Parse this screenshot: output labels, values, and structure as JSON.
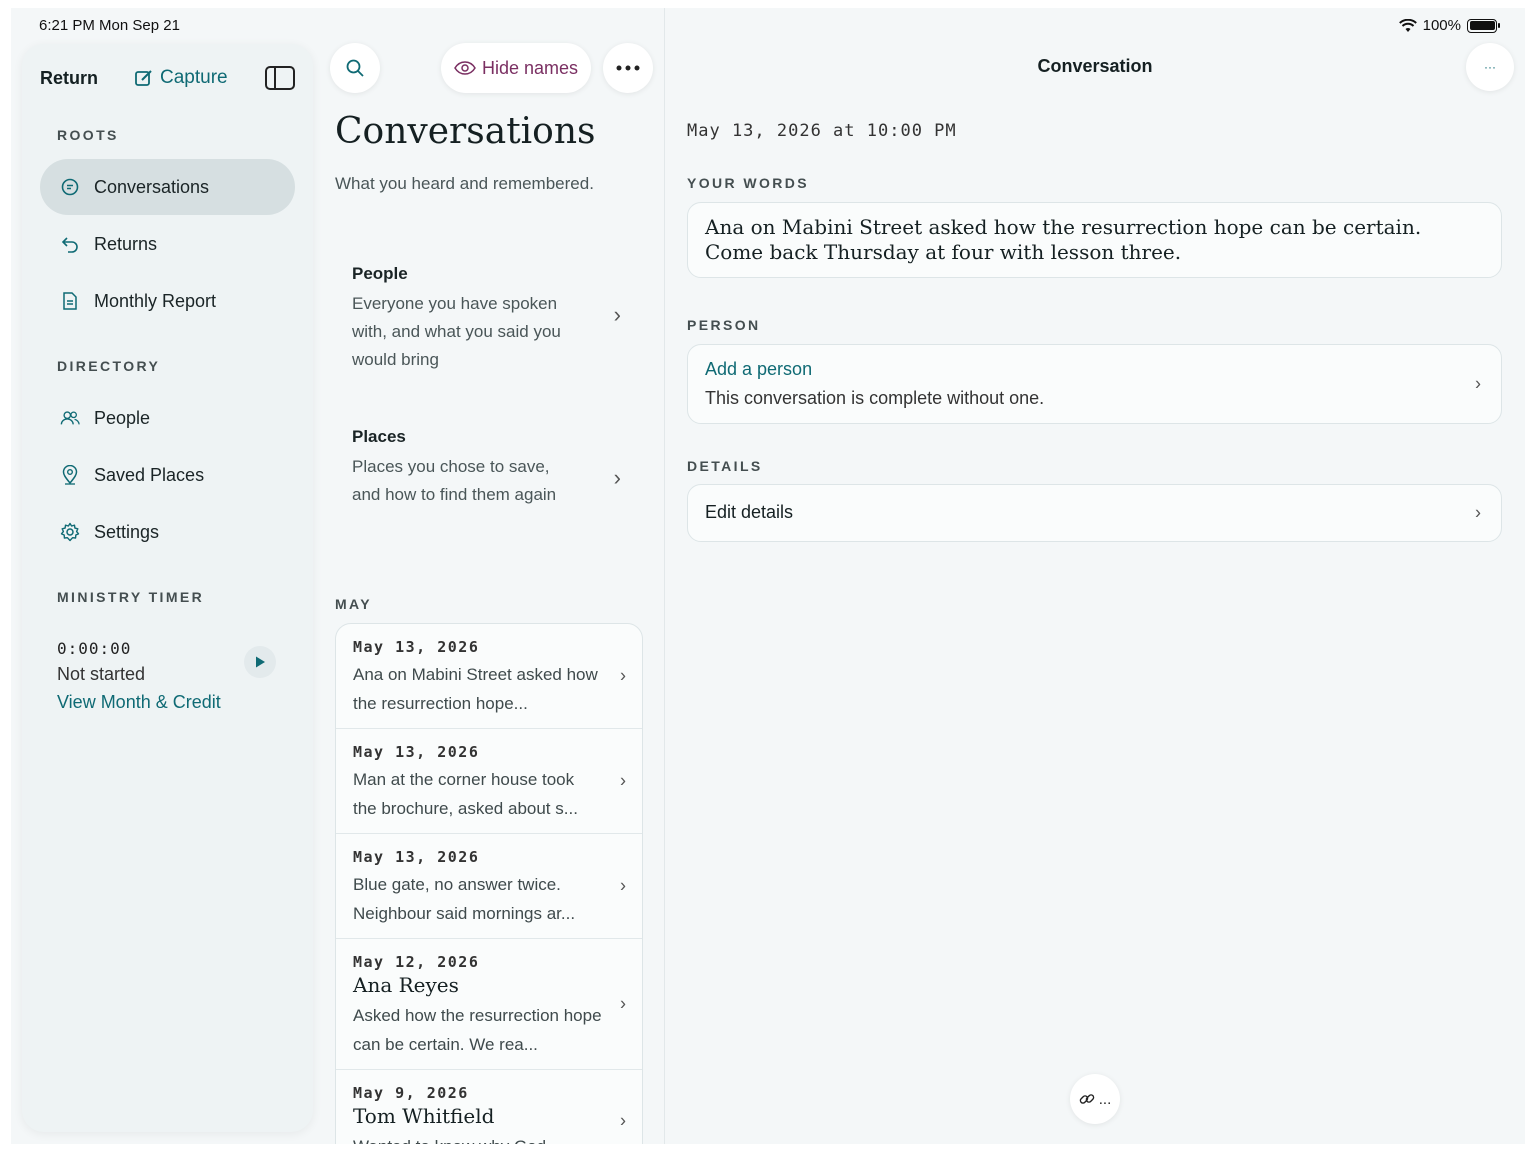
{
  "status_bar": {
    "time": "6:21 PM   Mon Sep 21",
    "battery": "100%"
  },
  "sidebar": {
    "return_label": "Return",
    "capture_label": "Capture",
    "roots_label": "ROOTS",
    "roots_items": [
      {
        "label": "Conversations",
        "icon": "chat-bubble-icon",
        "active": true
      },
      {
        "label": "Returns",
        "icon": "return-arrow-icon"
      },
      {
        "label": "Monthly Report",
        "icon": "document-icon"
      }
    ],
    "directory_label": "DIRECTORY",
    "directory_items": [
      {
        "label": "People",
        "icon": "people-icon"
      },
      {
        "label": "Saved Places",
        "icon": "map-pin-icon"
      },
      {
        "label": "Settings",
        "icon": "gear-icon"
      }
    ],
    "timer_label": "MINISTRY TIMER",
    "timer_value": "0:00:00",
    "timer_status": "Not started",
    "timer_link": "View Month & Credit"
  },
  "middle": {
    "hide_names_label": "Hide names",
    "title": "Conversations",
    "subtitle": "What you heard and remembered.",
    "categories": [
      {
        "title": "People",
        "desc": "Everyone you have spoken with, and what you said you would bring"
      },
      {
        "title": "Places",
        "desc": "Places you chose to save, and how to find them again"
      }
    ],
    "month_label": "MAY",
    "rows": [
      {
        "date": "May 13, 2026",
        "name": "",
        "text": "Ana on Mabini Street asked how the resurrection hope..."
      },
      {
        "date": "May 13, 2026",
        "name": "",
        "text": "Man at the corner house took the brochure, asked about s..."
      },
      {
        "date": "May 13, 2026",
        "name": "",
        "text": "Blue gate, no answer twice. Neighbour said mornings ar..."
      },
      {
        "date": "May 12, 2026",
        "name": "Ana Reyes",
        "text": "Asked how the resurrection hope can be certain. We rea..."
      },
      {
        "date": "May 9, 2026",
        "name": "Tom Whitfield",
        "text": "Wanted to know why God..."
      }
    ]
  },
  "detail": {
    "title": "Conversation",
    "date": "May 13, 2026 at 10:00 PM",
    "your_words_label": "YOUR WORDS",
    "your_words": "Ana on Mabini Street asked how the resurrection hope can be certain. Come back Thursday at four with lesson three.",
    "person_label": "PERSON",
    "add_person": "Add a person",
    "person_note": "This conversation is complete without one.",
    "details_label": "DETAILS",
    "edit_details": "Edit details",
    "more_glyph": "···",
    "link_glyph": "..."
  },
  "colors": {
    "accent": "#0f6a74",
    "hide_names": "#7a2f62",
    "background": "#f4f7f8"
  }
}
